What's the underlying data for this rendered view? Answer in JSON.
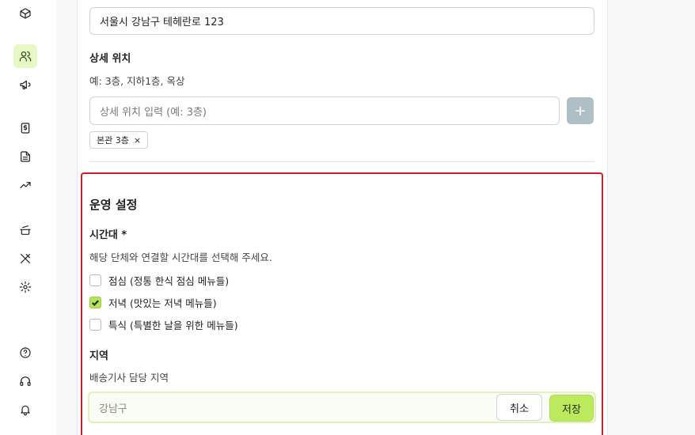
{
  "address": {
    "value": "서울시 강남구 테헤란로 123"
  },
  "detail_location": {
    "label": "상세 위치",
    "help": "예: 3층, 지하1층, 옥상",
    "placeholder": "상세 위치 입력 (예: 3층)",
    "add_label": "+",
    "chips": [
      {
        "label": "본관 3층",
        "remove": "×"
      }
    ]
  },
  "operations": {
    "title": "운영 설정",
    "timeslot": {
      "label": "시간대 *",
      "help": "해당 단체와 연결할 시간대를 선택해 주세요.",
      "options": [
        {
          "label": "점심 (정통 한식 점심 메뉴들)",
          "checked": false
        },
        {
          "label": "저녁 (맛있는 저녁 메뉴들)",
          "checked": true
        },
        {
          "label": "특식 (특별한 날을 위한 메뉴들)",
          "checked": false
        }
      ]
    },
    "region": {
      "label": "지역",
      "help": "배송기사 담당 지역",
      "value": "강남구",
      "cancel_label": "취소",
      "save_label": "저장"
    }
  },
  "sidebar": {
    "icons": [
      "box-icon",
      "users-icon",
      "megaphone-icon",
      "dollar-document-icon",
      "document-icon",
      "trending-up-icon",
      "cooking-pot-icon",
      "utensils-crossed-icon",
      "settings-icon",
      "help-circle-icon",
      "headset-icon",
      "bell-icon"
    ],
    "active": "users-icon"
  },
  "colors": {
    "accent": "#bde95f",
    "highlight_border": "#c8202a",
    "active_nav": "#e8f7c6"
  }
}
